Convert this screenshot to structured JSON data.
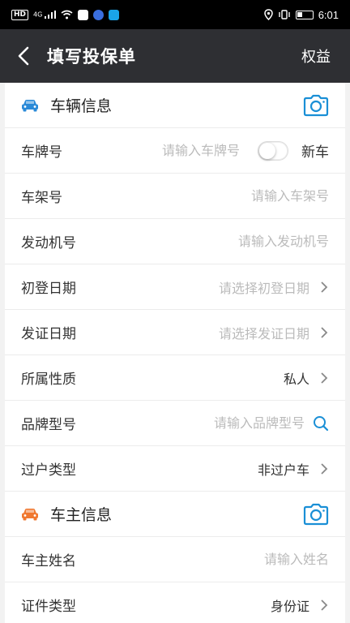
{
  "status_bar": {
    "time": "6:01",
    "network": "HD",
    "signal": "4G"
  },
  "header": {
    "title": "填写投保单",
    "right_action": "权益"
  },
  "colors": {
    "header_bg": "#2e2f33",
    "accent_blue": "#1a8fd6",
    "vehicle_icon": "#2a8ad8",
    "owner_icon": "#f07830"
  },
  "vehicle_section": {
    "title": "车辆信息",
    "icon": "car-icon",
    "camera_icon": "camera-icon",
    "rows": [
      {
        "label": "车牌号",
        "placeholder": "请输入车牌号",
        "toggle_label": "新车",
        "toggle_on": false
      },
      {
        "label": "车架号",
        "placeholder": "请输入车架号"
      },
      {
        "label": "发动机号",
        "placeholder": "请输入发动机号"
      },
      {
        "label": "初登日期",
        "placeholder": "请选择初登日期"
      },
      {
        "label": "发证日期",
        "placeholder": "请选择发证日期"
      },
      {
        "label": "所属性质",
        "value": "私人"
      },
      {
        "label": "品牌型号",
        "placeholder": "请输入品牌型号"
      },
      {
        "label": "过户类型",
        "value": "非过户车"
      }
    ]
  },
  "owner_section": {
    "title": "车主信息",
    "icon": "car-icon",
    "camera_icon": "camera-icon",
    "rows": [
      {
        "label": "车主姓名",
        "placeholder": "请输入姓名"
      },
      {
        "label": "证件类型",
        "value": "身份证"
      }
    ]
  }
}
